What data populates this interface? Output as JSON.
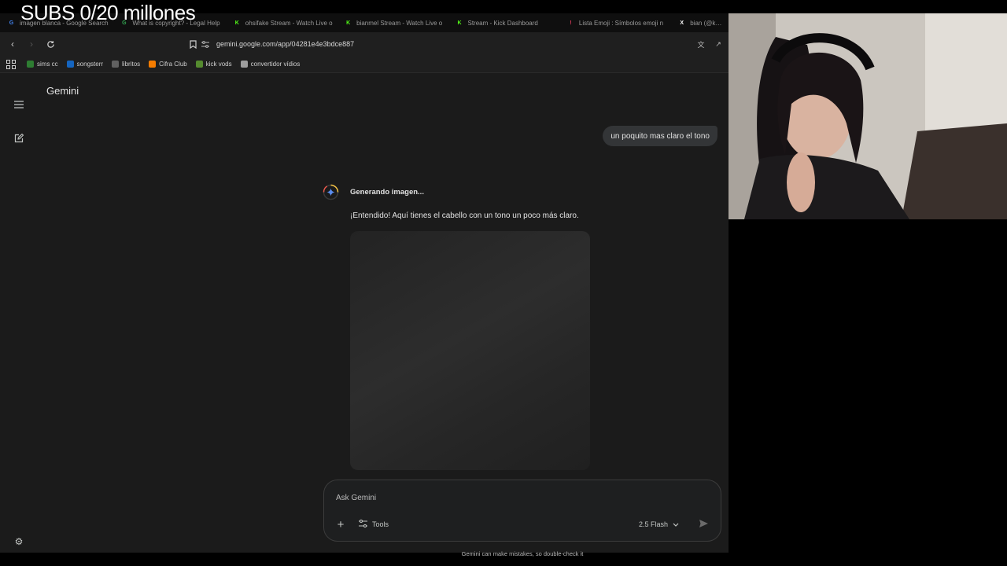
{
  "overlay": {
    "subs_text": "SUBS 0/20 millones"
  },
  "browser": {
    "tabs": [
      {
        "title": "imagen blanca - Google Search",
        "icon": "google-icon",
        "color": "#4285f4",
        "glyph": "G"
      },
      {
        "title": "What is copyright? - Legal Help",
        "icon": "google-icon",
        "color": "#34a853",
        "glyph": "G"
      },
      {
        "title": "ohsifake Stream - Watch Live o",
        "icon": "kick-icon",
        "color": "#53fc18",
        "glyph": "K"
      },
      {
        "title": "bianmel Stream - Watch Live o",
        "icon": "kick-icon",
        "color": "#53fc18",
        "glyph": "K"
      },
      {
        "title": "Stream - Kick Dashboard",
        "icon": "kick-icon",
        "color": "#53fc18",
        "glyph": "K"
      },
      {
        "title": "Lista Emoji : Símbolos emoji n",
        "icon": "emoji-icon",
        "color": "#e33b5b",
        "glyph": "!"
      },
      {
        "title": "bian (@kynm",
        "icon": "x-icon",
        "color": "#ffffff",
        "glyph": "X"
      }
    ],
    "url": "gemini.google.com/app/04281e4e3bdce887",
    "bookmarks": [
      {
        "label": "sims cc",
        "color": "#2e7d32"
      },
      {
        "label": "songsterr",
        "color": "#1565c0"
      },
      {
        "label": "libritos",
        "color": "#616161"
      },
      {
        "label": "Cifra Club",
        "color": "#f57c00"
      },
      {
        "label": "kick vods",
        "color": "#558b2f"
      },
      {
        "label": "convertidor vídios",
        "color": "#9e9e9e"
      }
    ]
  },
  "gemini": {
    "app_title": "Gemini",
    "user_message": "un poquito mas claro el tono",
    "status": "Generando imagen...",
    "reply": "¡Entendido! Aquí tienes el cabello con un tono un poco más claro.",
    "input_placeholder": "Ask Gemini",
    "tools_label": "Tools",
    "model_label": "2.5 Flash",
    "disclaimer": "Gemini can make mistakes, so double-check it"
  }
}
